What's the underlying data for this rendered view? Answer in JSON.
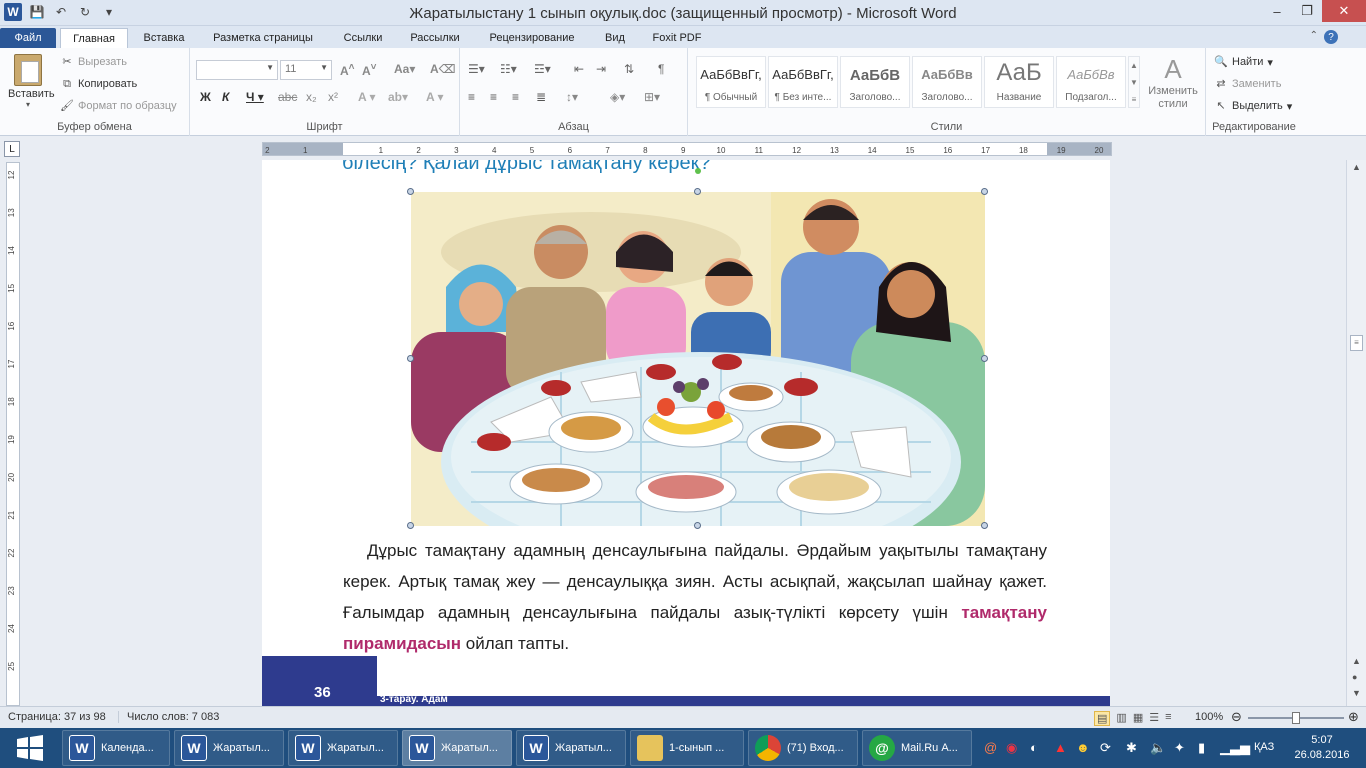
{
  "window": {
    "title": "Жаратылыстану 1 сынып оқулық.doc (защищенный просмотр) - Microsoft Word"
  },
  "tabs": [
    "Файл",
    "Главная",
    "Вставка",
    "Разметка страницы",
    "Ссылки",
    "Рассылки",
    "Рецензирование",
    "Вид",
    "Foxit PDF"
  ],
  "ribbon": {
    "clipboard": {
      "paste_label": "Вставить",
      "cut_label": "Вырезать",
      "copy_label": "Копировать",
      "format_painter_label": "Формат по образцу",
      "group_label": "Буфер обмена"
    },
    "font": {
      "font_name": "",
      "font_size": "11",
      "group_label": "Шрифт"
    },
    "paragraph": {
      "group_label": "Абзац"
    },
    "styles": {
      "group_label": "Стили",
      "change_styles_label": "Изменить стили",
      "items": [
        {
          "sample": "АаБбВвГг,",
          "name": "¶ Обычный"
        },
        {
          "sample": "АаБбВвГг,",
          "name": "¶ Без инте..."
        },
        {
          "sample": "АаБбВ",
          "name": "Заголово..."
        },
        {
          "sample": "АаБбВв",
          "name": "Заголово..."
        },
        {
          "sample": "АаБ",
          "name": "Название"
        },
        {
          "sample": "АаБбВв",
          "name": "Подзагол..."
        }
      ]
    },
    "editing": {
      "group_label": "Редактирование",
      "find_label": "Найти",
      "replace_label": "Заменить",
      "select_label": "Выделить"
    }
  },
  "document": {
    "heading_partial": "білесің? Қалай дұрыс тамақтану керек?",
    "paragraph_before": "Дұрыс тамақтану адамның денсаулығына пайдалы. Әрдайым уақытылы тамақтану керек. Артық тамақ жеу — денсаулыққа зиян. Асты асықпай, жақсылап шайнау қажет. Ғалымдар адамның денсаулығына пайдалы азық-түлікті көрсету үшін ",
    "paragraph_highlight": "тамақтану пирамидасын",
    "paragraph_after": " ойлап тапты.",
    "page_number": "36",
    "section_label": "3-тарау. Адам"
  },
  "statusbar": {
    "page": "Страница: 37 из 98",
    "words": "Число слов: 7 083",
    "zoom": "100%"
  },
  "taskbar": {
    "items": [
      {
        "label": "Календа...",
        "icon": "word-icon"
      },
      {
        "label": "Жаратыл...",
        "icon": "word-icon"
      },
      {
        "label": "Жаратыл...",
        "icon": "word-icon"
      },
      {
        "label": "Жаратыл...",
        "icon": "word-icon"
      },
      {
        "label": "Жаратыл...",
        "icon": "word-icon"
      },
      {
        "label": "1-сынып ...",
        "icon": "folder-icon"
      },
      {
        "label": "(71) Вход...",
        "icon": "chrome-icon"
      },
      {
        "label": "Mail.Ru А...",
        "icon": "mail-icon"
      }
    ],
    "language": "ҚАЗ",
    "time": "5:07",
    "date": "26.08.2016"
  }
}
